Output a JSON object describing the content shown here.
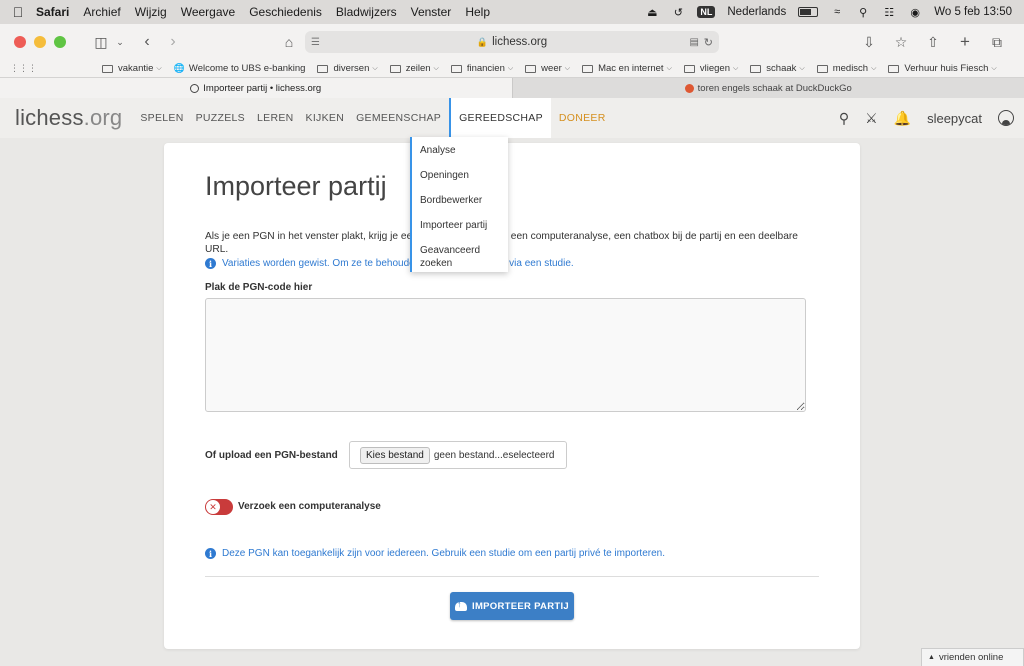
{
  "menubar": {
    "items": [
      "Safari",
      "Archief",
      "Wijzig",
      "Weergave",
      "Geschiedenis",
      "Bladwijzers",
      "Venster",
      "Help"
    ],
    "language_badge": "NL",
    "language": "Nederlands",
    "clock": "Wo 5 feb  13:50"
  },
  "browser": {
    "url": "lichess.org",
    "bookmarks": [
      {
        "label": "vakantie",
        "type": "folder"
      },
      {
        "label": "Welcome to UBS e-banking",
        "type": "link"
      },
      {
        "label": "diversen",
        "type": "folder"
      },
      {
        "label": "zeilen",
        "type": "folder"
      },
      {
        "label": "financien",
        "type": "folder"
      },
      {
        "label": "weer",
        "type": "folder"
      },
      {
        "label": "Mac en internet",
        "type": "folder"
      },
      {
        "label": "vliegen",
        "type": "folder"
      },
      {
        "label": "schaak",
        "type": "folder"
      },
      {
        "label": "medisch",
        "type": "folder"
      },
      {
        "label": "Verhuur huis Fiesch",
        "type": "folder"
      }
    ],
    "tabs": [
      {
        "label": "Importeer partij • lichess.org",
        "active": true
      },
      {
        "label": "toren engels schaak at DuckDuckGo",
        "active": false
      }
    ]
  },
  "site": {
    "logo_main": "lichess",
    "logo_tld": ".org",
    "nav": [
      "SPELEN",
      "PUZZELS",
      "LEREN",
      "KIJKEN",
      "GEMEENSCHAP",
      "GEREEDSCHAP",
      "DONEER"
    ],
    "username": "sleepycat",
    "tools_menu": [
      "Analyse",
      "Openingen",
      "Bordbewerker",
      "Importeer partij",
      "Geavanceerd zoeken"
    ]
  },
  "page": {
    "title": "Importeer partij",
    "intro": "Als je een PGN in het venster plakt, krijg je een herspeelbare partij, een computeranalyse, een chatbox bij de partij en een deelbare URL.",
    "variations_note": "Variaties worden gewist. Om ze te behouden, importeer de PGN via een studie.",
    "pgn_label": "Plak de PGN-code hier",
    "pgn_value": "",
    "upload_label": "Of upload een PGN-bestand",
    "file_button": "Kies bestand",
    "file_status": "geen bestand...eselecteerd",
    "analysis_label": "Verzoek een computeranalyse",
    "analysis_enabled": false,
    "public_note": "Deze PGN kan toegankelijk zijn voor iedereen. Gebruik een studie om een partij privé te importeren.",
    "import_button": "IMPORTEER PARTIJ"
  },
  "friends_box": "vrienden online",
  "colors": {
    "accent_blue": "#3893e8",
    "button_blue": "#3c7fc6",
    "donate_orange": "#d59020",
    "toggle_red": "#c93b3b",
    "info_blue": "#2f7ad1"
  }
}
